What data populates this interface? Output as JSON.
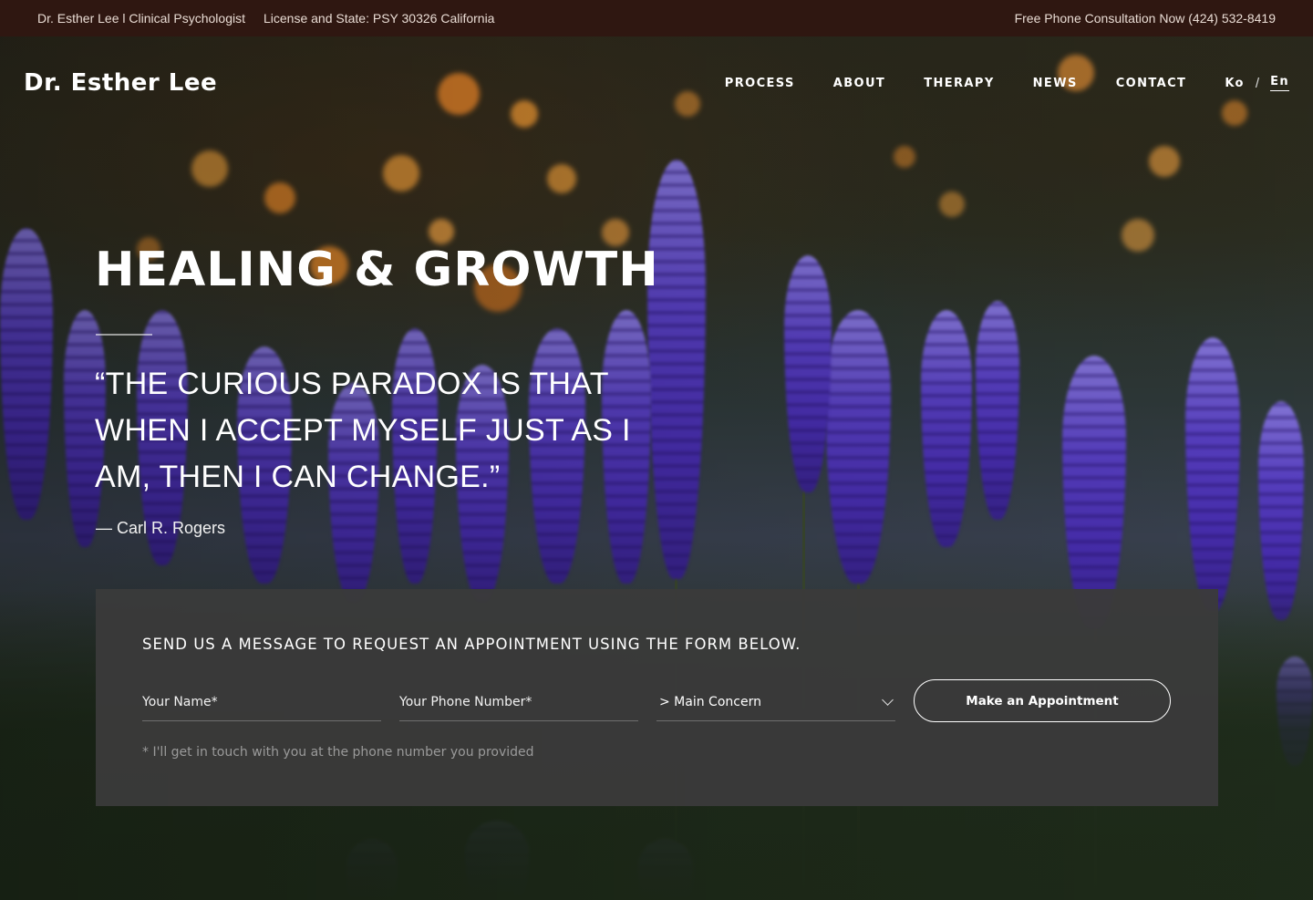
{
  "topbar": {
    "name_title": "Dr. Esther Lee l Clinical Psychologist",
    "license": "License and State: PSY 30326 California",
    "phone": "Free Phone Consultation Now (424) 532-8419"
  },
  "header": {
    "logo": "Dr. Esther Lee",
    "nav": [
      "PROCESS",
      "ABOUT",
      "THERAPY",
      "NEWS",
      "CONTACT"
    ],
    "lang_ko": "Ko",
    "lang_sep": "/",
    "lang_en": "En",
    "active_lang": "En"
  },
  "hero": {
    "title": "HEALING & GROWTH",
    "quote": "“THE CURIOUS PARADOX IS THAT WHEN I ACCEPT MYSELF JUST AS I AM, THEN I CAN CHANGE.”",
    "author": "— Carl R. Rogers"
  },
  "form": {
    "heading": "SEND US A MESSAGE TO REQUEST AN APPOINTMENT USING THE FORM BELOW.",
    "name_placeholder": "Your Name*",
    "phone_placeholder": "Your Phone Number*",
    "concern_selected": "> Main Concern",
    "submit_label": "Make an Appointment",
    "note": "* I'll get in touch with you at the phone number you provided"
  },
  "colors": {
    "topbar_bg": "#2f1711",
    "panel_bg": "#3a3a3a",
    "flower": "#5b42c8",
    "bokeh": "#f0902a"
  }
}
